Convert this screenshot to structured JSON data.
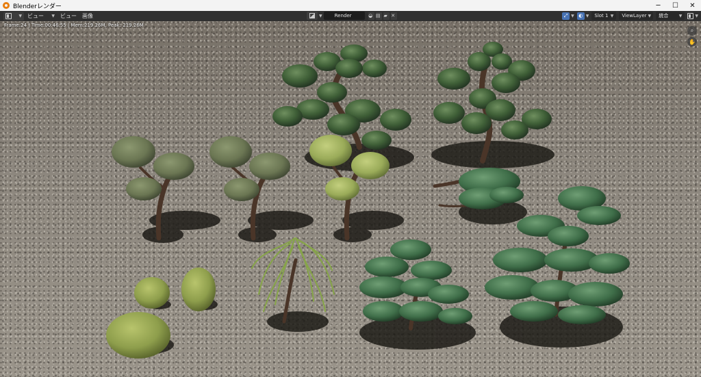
{
  "window": {
    "title": "Blenderレンダー",
    "minimize_glyph": "─",
    "maximize_glyph": "☐",
    "close_glyph": "✕"
  },
  "header": {
    "view_dropdown": "ビュー",
    "menu_view": "ビュー",
    "menu_image": "画像",
    "image_name": "Render Result",
    "slot": "Slot 1",
    "view_layer": "ViewLayer",
    "pass": "統合"
  },
  "viewport": {
    "render_info": "Frame:24 | Time:00:46.55 | Mem:219.26M, Peak: 219.26M"
  },
  "icons": {
    "app": "blender-logo-icon",
    "editor_type": "image-editor-icon",
    "image_type": "image-icon",
    "fake_user": "shield-icon",
    "new_image": "new-image-icon",
    "open_image": "folder-icon",
    "unlink": "close-icon",
    "tool": "sample-tool-icon",
    "display_channels": "color-channels-icon",
    "zoom": "magnify-icon",
    "pan": "hand-icon"
  },
  "colors": {
    "accent_blue": "#4772b3",
    "header_bg": "#303030",
    "title_bar_bg": "#f3f3f3"
  }
}
